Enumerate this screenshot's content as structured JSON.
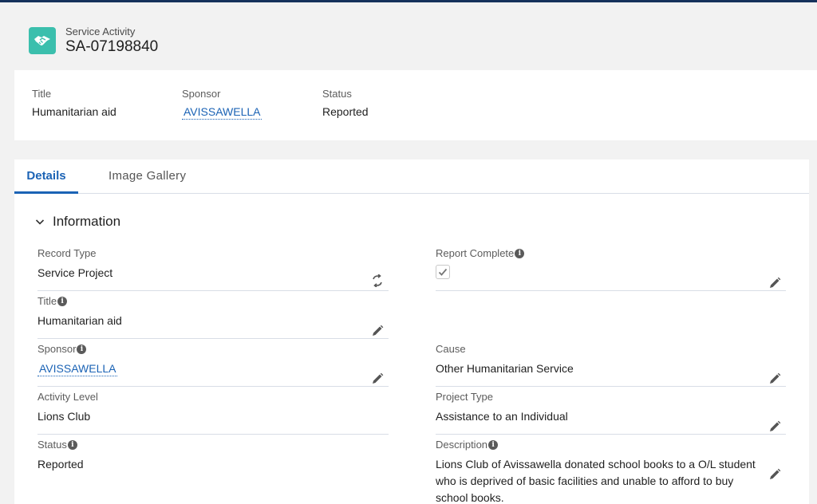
{
  "header": {
    "object_type": "Service Activity",
    "record_name": "SA-07198840",
    "icon": "handshake-icon",
    "icon_color": "#3bbfad"
  },
  "highlights": {
    "title_label": "Title",
    "title_value": "Humanitarian aid",
    "sponsor_label": "Sponsor",
    "sponsor_value": "AVISSAWELLA",
    "status_label": "Status",
    "status_value": "Reported"
  },
  "tabs": [
    {
      "label": "Details",
      "active": true
    },
    {
      "label": "Image Gallery",
      "active": false
    }
  ],
  "section": {
    "title": "Information",
    "expanded": true
  },
  "fields_left": {
    "record_type": {
      "label": "Record Type",
      "value": "Service Project"
    },
    "title": {
      "label": "Title",
      "value": "Humanitarian aid"
    },
    "sponsor": {
      "label": "Sponsor",
      "value": "AVISSAWELLA"
    },
    "activity_level": {
      "label": "Activity Level",
      "value": "Lions Club"
    },
    "status": {
      "label": "Status",
      "value": "Reported"
    }
  },
  "fields_right": {
    "report_complete": {
      "label": "Report Complete",
      "checked": true
    },
    "cause": {
      "label": "Cause",
      "value": "Other Humanitarian Service"
    },
    "project_type": {
      "label": "Project Type",
      "value": "Assistance to an Individual"
    },
    "description": {
      "label": "Description",
      "value": "Lions Club of Avissawella donated school books to a O/L student who is deprived of basic facilities and unable to afford to buy school books."
    }
  },
  "colors": {
    "accent": "#1b63b5",
    "top_bar": "#16325c",
    "background": "#f2f2f2"
  }
}
